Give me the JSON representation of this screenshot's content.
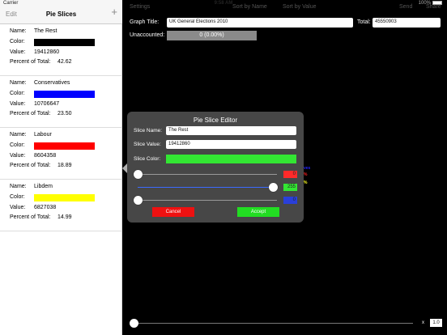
{
  "status_bar": {
    "carrier": "Carrier",
    "time": "9:58 AM",
    "battery": "100%"
  },
  "sidebar": {
    "edit_label": "Edit",
    "title": "Pie Slices",
    "add_icon": "plus-icon",
    "labels": {
      "name": "Name:",
      "color": "Color:",
      "value": "Value:",
      "percent": "Percent of Total:"
    },
    "slices": [
      {
        "name": "The Rest",
        "color": "#000000",
        "value": "19412860",
        "percent": "42.62"
      },
      {
        "name": "Conservatives",
        "color": "#0000ff",
        "value": "10706647",
        "percent": "23.50"
      },
      {
        "name": "Labour",
        "color": "#ff0000",
        "value": "8604358",
        "percent": "18.89"
      },
      {
        "name": "Libdem",
        "color": "#ffff00",
        "value": "6827038",
        "percent": "14.99"
      }
    ]
  },
  "toolbar": {
    "settings": "Settings",
    "sort_by_name": "Sort by Name",
    "sort_by_value": "Sort by Value",
    "send": "Send",
    "share": "Share"
  },
  "graph": {
    "title_label": "Graph Title:",
    "title_value": "UK General Elections 2010",
    "total_label": "Total:",
    "total_value": "45550903",
    "unaccounted_label": "Unaccounted:",
    "unaccounted_value": "0 (0.00%)"
  },
  "editor": {
    "title": "Pie Slice Editor",
    "name_label": "Slice Name:",
    "name_value": "The Rest",
    "value_label": "Slice Value:",
    "value_value": "19412860",
    "color_label": "Slice Color:",
    "color_value": "#33e633",
    "red": "0",
    "green": "255",
    "blue": "0",
    "cancel": "Cancel",
    "accept": "Accept"
  },
  "peek_labels": {
    "blue_text": "ves",
    "red_text": "%",
    "yellow_text": "%"
  },
  "zoom": {
    "x_label": "x",
    "value": "1.0"
  }
}
